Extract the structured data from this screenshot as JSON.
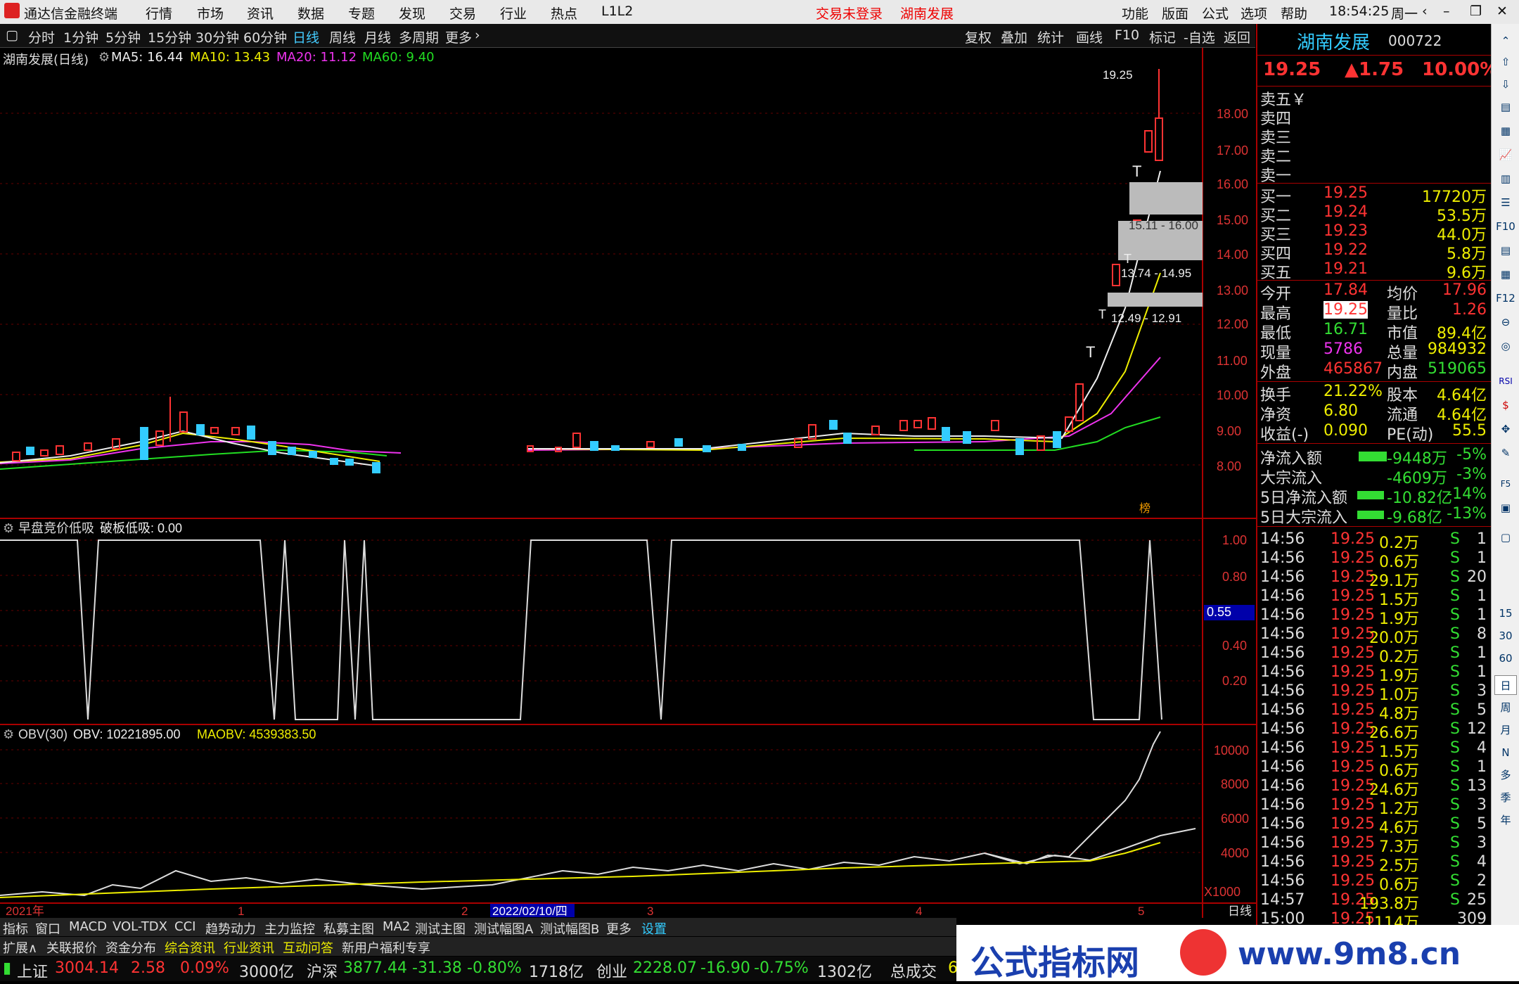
{
  "app": {
    "title": "通达信金融终端",
    "menu": [
      "行情",
      "市场",
      "资讯",
      "数据",
      "专题",
      "发现",
      "交易",
      "行业",
      "热点",
      "L1L2"
    ],
    "trade_status": "交易未登录",
    "stock_title": "湖南发展",
    "right_menu": [
      "功能",
      "版面",
      "公式",
      "选项",
      "帮助"
    ],
    "clock": "18:54:25",
    "weekday": "周一"
  },
  "periods": [
    "分时",
    "1分钟",
    "5分钟",
    "15分钟",
    "30分钟",
    "60分钟",
    "日线",
    "周线",
    "月线",
    "多周期",
    "更多"
  ],
  "tools": [
    "复权",
    "叠加",
    "统计",
    "画线",
    "F10",
    "标记",
    "-自选",
    "返回"
  ],
  "kline": {
    "label": "湖南发展(日线)",
    "ma5": "MA5: 16.44",
    "ma10": "MA10: 13.43",
    "ma20": "MA20: 11.12",
    "ma60": "MA60: 9.40",
    "high_note": "19.25",
    "zone1": "15.11 - 16.00",
    "zone2": "13.74 - 14.95",
    "zone3": "12.49 - 12.91",
    "ticks": [
      "18.00",
      "17.00",
      "16.00",
      "15.00",
      "14.00",
      "13.00",
      "12.00",
      "11.00",
      "10.00",
      "9.00",
      "8.00"
    ],
    "badge": "榜"
  },
  "ind1": {
    "label": "早盘竞价低吸",
    "value": "破板低吸: 0.00",
    "ticks": [
      "1.00",
      "0.80",
      "0.55",
      "0.40",
      "0.20"
    ]
  },
  "ind2": {
    "label": "OBV(30)",
    "obv": "OBV: 10221895.00",
    "maobv": "MAOBV: 4539383.50",
    "ticks": [
      "10000",
      "8000",
      "6000",
      "4000",
      "X1000"
    ]
  },
  "xaxis": {
    "year": "2021年",
    "m1": "1",
    "m2": "2",
    "date": "2022/02/10/四",
    "m3": "3",
    "m4": "4",
    "m5": "5",
    "period": "日线"
  },
  "quote": {
    "name": "湖南发展",
    "code": "000722",
    "price": "19.25",
    "change": "▲1.75",
    "pct": "10.00%",
    "sells": [
      "卖五￥",
      "卖四",
      "卖三",
      "卖二",
      "卖一"
    ],
    "buys": [
      [
        "买一",
        "19.25",
        "17720万"
      ],
      [
        "买二",
        "19.24",
        "53.5万"
      ],
      [
        "买三",
        "19.23",
        "44.0万"
      ],
      [
        "买四",
        "19.22",
        "5.8万"
      ],
      [
        "买五",
        "19.21",
        "9.6万"
      ]
    ],
    "stats": [
      [
        "今开",
        "17.84",
        "均价",
        "17.96"
      ],
      [
        "最高",
        "19.25",
        "量比",
        "1.26"
      ],
      [
        "最低",
        "16.71",
        "市值",
        "89.4亿"
      ],
      [
        "现量",
        "5786",
        "总量",
        "984932"
      ],
      [
        "外盘",
        "465867",
        "内盘",
        "519065"
      ]
    ],
    "stats2": [
      [
        "换手",
        "21.22%",
        "股本",
        "4.64亿"
      ],
      [
        "净资",
        "6.80",
        "流通",
        "4.64亿"
      ],
      [
        "收益(-)",
        "0.090",
        "PE(动)",
        "55.5"
      ]
    ],
    "flows": [
      [
        "净流入额",
        "-9448万",
        "-5%"
      ],
      [
        "大宗流入",
        "-4609万",
        "-3%"
      ],
      [
        "5日净流入额",
        "-10.82亿",
        "-14%"
      ],
      [
        "5日大宗流入",
        "-9.68亿",
        "-13%"
      ]
    ],
    "ticks": [
      [
        "14:56",
        "19.25",
        "0.2万",
        "S",
        "1"
      ],
      [
        "14:56",
        "19.25",
        "0.6万",
        "S",
        "1"
      ],
      [
        "14:56",
        "19.25",
        "29.1万",
        "S",
        "20"
      ],
      [
        "14:56",
        "19.25",
        "1.5万",
        "S",
        "1"
      ],
      [
        "14:56",
        "19.25",
        "1.9万",
        "S",
        "1"
      ],
      [
        "14:56",
        "19.25",
        "20.0万",
        "S",
        "8"
      ],
      [
        "14:56",
        "19.25",
        "0.2万",
        "S",
        "1"
      ],
      [
        "14:56",
        "19.25",
        "1.9万",
        "S",
        "1"
      ],
      [
        "14:56",
        "19.25",
        "1.0万",
        "S",
        "3"
      ],
      [
        "14:56",
        "19.25",
        "4.8万",
        "S",
        "5"
      ],
      [
        "14:56",
        "19.25",
        "26.6万",
        "S",
        "12"
      ],
      [
        "14:56",
        "19.25",
        "1.5万",
        "S",
        "4"
      ],
      [
        "14:56",
        "19.25",
        "0.6万",
        "S",
        "1"
      ],
      [
        "14:56",
        "19.25",
        "24.6万",
        "S",
        "13"
      ],
      [
        "14:56",
        "19.25",
        "1.2万",
        "S",
        "3"
      ],
      [
        "14:56",
        "19.25",
        "4.6万",
        "S",
        "5"
      ],
      [
        "14:56",
        "19.25",
        "7.3万",
        "S",
        "3"
      ],
      [
        "14:56",
        "19.25",
        "2.5万",
        "S",
        "4"
      ],
      [
        "14:56",
        "19.25",
        "0.6万",
        "S",
        "2"
      ],
      [
        "14:57",
        "19.25",
        "193.8万",
        "S",
        "25"
      ],
      [
        "15:00",
        "19.25",
        "1114万",
        "",
        "309"
      ]
    ]
  },
  "sidebar": [
    "15",
    "30",
    "60",
    "日",
    "周",
    "月",
    "N",
    "多",
    "季",
    "年"
  ],
  "tabs1": [
    "指标",
    "窗口",
    "MACD",
    "VOL-TDX",
    "CCI",
    "趋势动力",
    "主力监控",
    "私募主图",
    "MA2",
    "测试主图",
    "测试幅图A",
    "测试幅图B",
    "更多",
    "设置"
  ],
  "tabs2": [
    "扩展∧",
    "关联报价",
    "资金分布",
    "综合资讯",
    "行业资讯",
    "互动问答",
    "新用户福利专享"
  ],
  "status": {
    "sh": "上证",
    "sh_v": "3004.14",
    "sh_c": "2.58",
    "sh_p": "0.09%",
    "sh_a": "3000亿",
    "hs": "沪深",
    "hs_v": "3877.44",
    "hs_c": "-31.38",
    "hs_p": "-0.80%",
    "hs_a": "1718亿",
    "cy": "创业",
    "cy_v": "2228.07",
    "cy_c": "-16.90",
    "cy_p": "-0.75%",
    "cy_a": "1302亿",
    "total": "总成交",
    "total_v": "6"
  },
  "banner": {
    "text": "公式指标网",
    "url": "www.9m8.cn"
  }
}
